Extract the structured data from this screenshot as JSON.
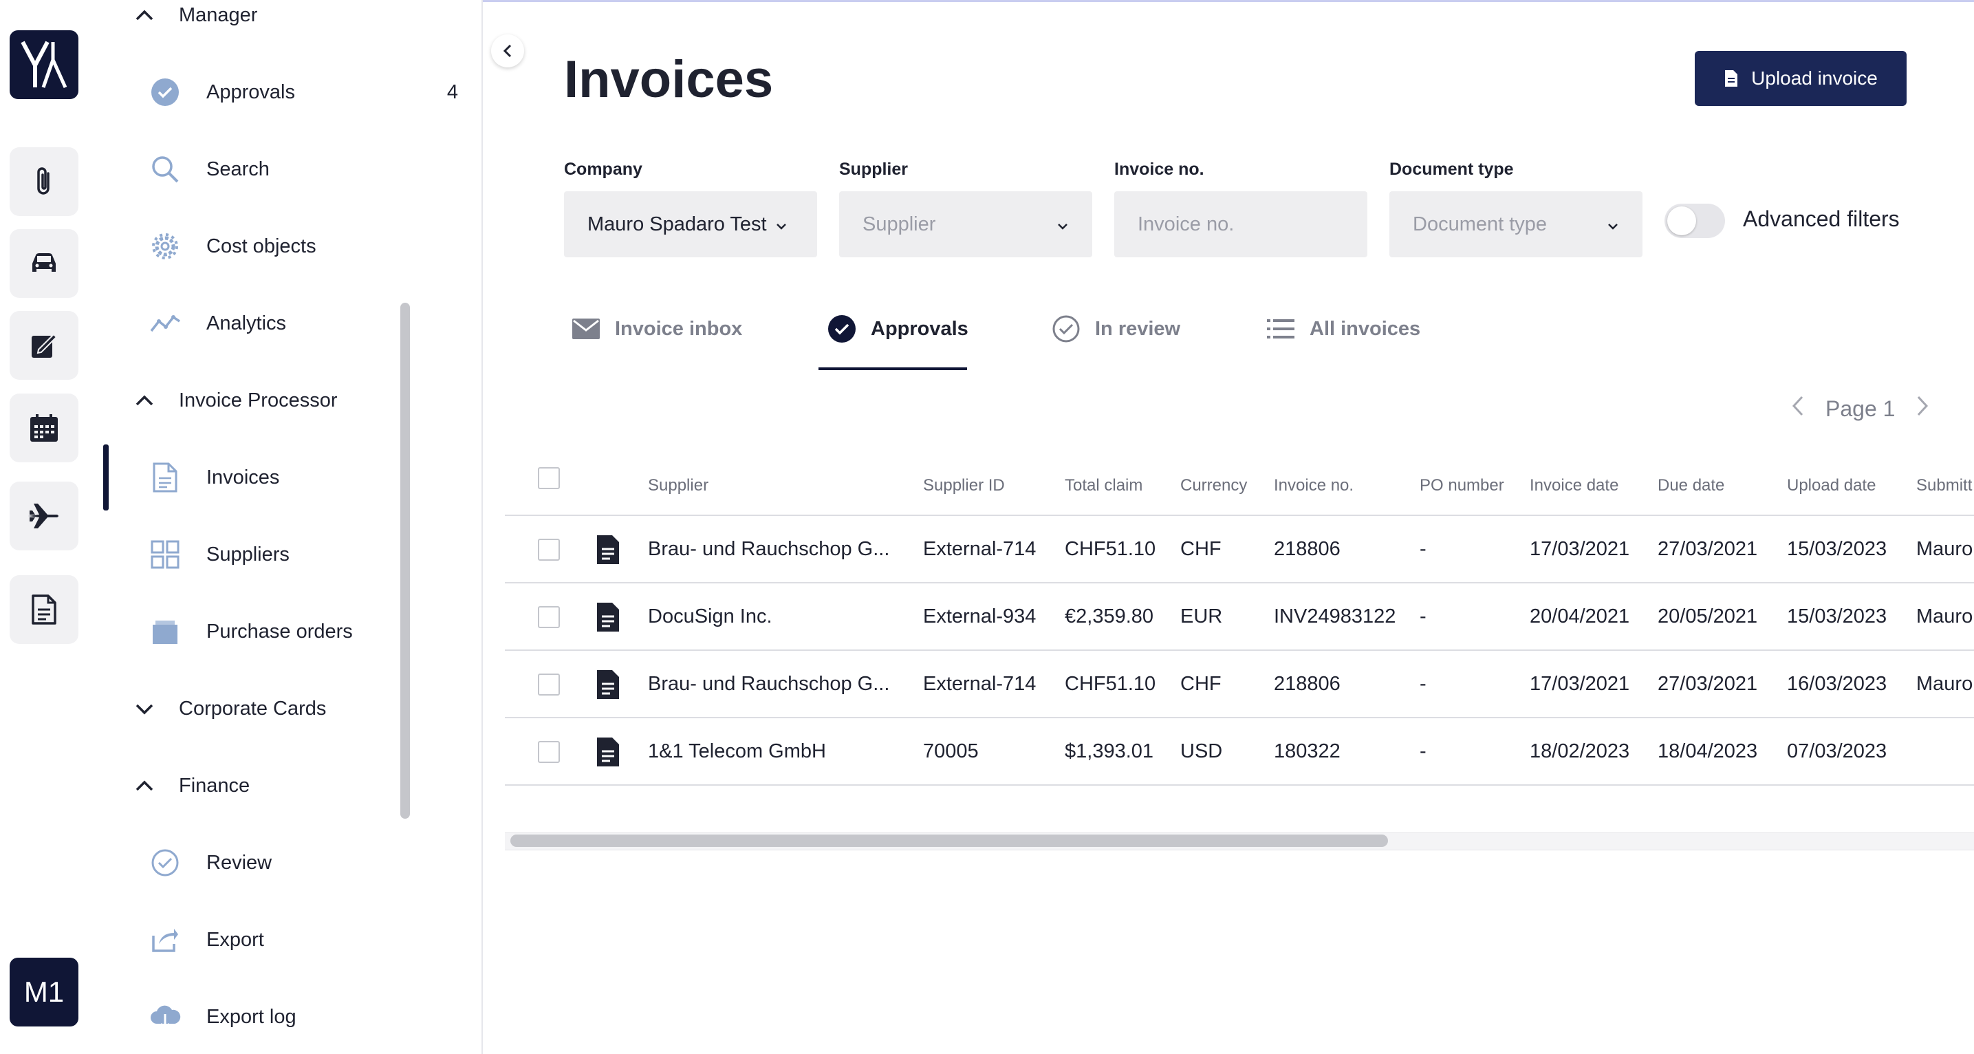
{
  "user": {
    "initials": "M1"
  },
  "sidebar": {
    "sections": [
      {
        "label": "Manager",
        "expanded": true
      },
      {
        "label": "Invoice Processor",
        "expanded": true
      },
      {
        "label": "Corporate Cards",
        "expanded": false
      },
      {
        "label": "Finance",
        "expanded": true
      }
    ],
    "items": [
      {
        "label": "Approvals",
        "count": "4",
        "icon": "check-circle-icon"
      },
      {
        "label": "Search",
        "icon": "search-icon"
      },
      {
        "label": "Cost objects",
        "icon": "gear-icon"
      },
      {
        "label": "Analytics",
        "icon": "analytics-icon"
      },
      {
        "label": "Invoices",
        "icon": "document-icon",
        "active": true
      },
      {
        "label": "Suppliers",
        "icon": "grid-icon"
      },
      {
        "label": "Purchase orders",
        "icon": "inbox-tray-icon"
      },
      {
        "label": "Review",
        "icon": "check-circle-outline-icon"
      },
      {
        "label": "Export",
        "icon": "export-icon"
      },
      {
        "label": "Export log",
        "icon": "cloud-download-icon"
      }
    ]
  },
  "page": {
    "title": "Invoices",
    "upload_label": "Upload invoice"
  },
  "filters": {
    "company": {
      "label": "Company",
      "value": "Mauro Spadaro Test"
    },
    "supplier": {
      "label": "Supplier",
      "placeholder": "Supplier"
    },
    "invoice_no": {
      "label": "Invoice no.",
      "placeholder": "Invoice no."
    },
    "document_type": {
      "label": "Document type",
      "placeholder": "Document type"
    },
    "advanced_label": "Advanced filters",
    "advanced_on": false
  },
  "tabs": [
    {
      "label": "Invoice inbox",
      "icon": "mail-icon"
    },
    {
      "label": "Approvals",
      "icon": "check-circle-filled-icon",
      "active": true
    },
    {
      "label": "In review",
      "icon": "check-circle-outline-icon"
    },
    {
      "label": "All invoices",
      "icon": "list-icon"
    }
  ],
  "pager": {
    "label": "Page 1"
  },
  "table": {
    "columns": [
      "Supplier",
      "Supplier ID",
      "Total claim",
      "Currency",
      "Invoice no.",
      "PO number",
      "Invoice date",
      "Due date",
      "Upload date",
      "Submitt"
    ],
    "rows": [
      [
        "Brau- und Rauchschop G...",
        "External-714",
        "CHF51.10",
        "CHF",
        "218806",
        "-",
        "17/03/2021",
        "27/03/2021",
        "15/03/2023",
        "Mauro"
      ],
      [
        "DocuSign Inc.",
        "External-934",
        "€2,359.80",
        "EUR",
        "INV24983122",
        "-",
        "20/04/2021",
        "20/05/2021",
        "15/03/2023",
        "Mauro"
      ],
      [
        "Brau- und Rauchschop G...",
        "External-714",
        "CHF51.10",
        "CHF",
        "218806",
        "-",
        "17/03/2021",
        "27/03/2021",
        "16/03/2023",
        "Mauro"
      ],
      [
        "1&1 Telecom GmbH",
        "70005",
        "$1,393.01",
        "USD",
        "180322",
        "-",
        "18/02/2023",
        "18/04/2023",
        "07/03/2023",
        ""
      ]
    ]
  },
  "colors": {
    "brand": "#101636",
    "button": "#1b2757",
    "icon_blue": "#8fa9cf"
  }
}
